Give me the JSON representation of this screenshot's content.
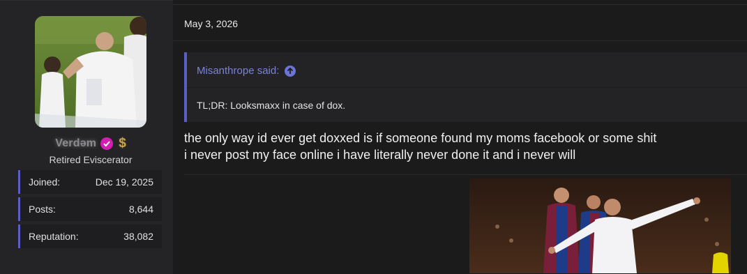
{
  "user": {
    "name": "Verdəm",
    "title": "Retired Eviscerator",
    "badge_icon": "verified-check-icon",
    "money_icon": "dollar-sign-icon",
    "stats": [
      {
        "label": "Joined:",
        "value": "Dec 19, 2025"
      },
      {
        "label": "Posts:",
        "value": "8,644"
      },
      {
        "label": "Reputation:",
        "value": "38,082"
      }
    ]
  },
  "post": {
    "date": "May 3, 2026",
    "quote": {
      "author": "Misanthrope said:",
      "text": "TL;DR: Looksmaxx in case of dox."
    },
    "lines": [
      "the only way id ever get doxxed is if someone found my moms facebook or some shit",
      "i never post my face online i have literally never done it and i never will"
    ]
  },
  "colors": {
    "accent": "#5a5ec6",
    "quote_author": "#7c82d6",
    "verified": "#d21fb0"
  }
}
